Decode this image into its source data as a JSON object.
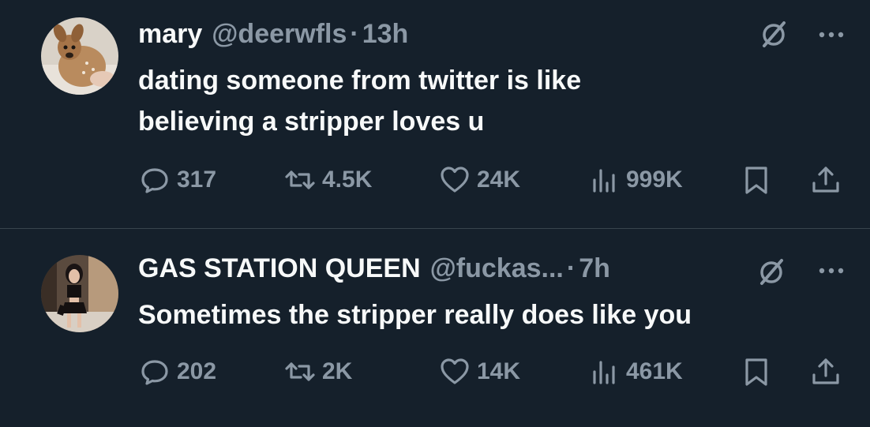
{
  "tweets": [
    {
      "name": "mary",
      "handle": "@deerwfls",
      "separator": "·",
      "time": "13h",
      "text_lines": [
        "dating someone from twitter is like",
        "believing a stripper loves u"
      ],
      "avatar_icon": "fawn-avatar",
      "replies": "317",
      "retweets": "4.5K",
      "likes": "24K",
      "views": "999K"
    },
    {
      "name": "GAS STATION QUEEN",
      "handle": "@fuckas...",
      "separator": "·",
      "time": "7h",
      "text_lines": [
        "Sometimes the stripper really does like you"
      ],
      "avatar_icon": "person-avatar",
      "replies": "202",
      "retweets": "2K",
      "likes": "14K",
      "views": "461K"
    }
  ],
  "icons": {
    "reply": "reply-icon",
    "retweet": "retweet-icon",
    "like": "heart-icon",
    "views": "views-icon",
    "bookmark": "bookmark-icon",
    "share": "share-icon",
    "grok": "grok-icon",
    "more": "more-icon"
  },
  "colors": {
    "background": "#15202b",
    "primary_text": "#f7f9f9",
    "secondary_text": "#8b98a5",
    "divider": "#38444d"
  }
}
